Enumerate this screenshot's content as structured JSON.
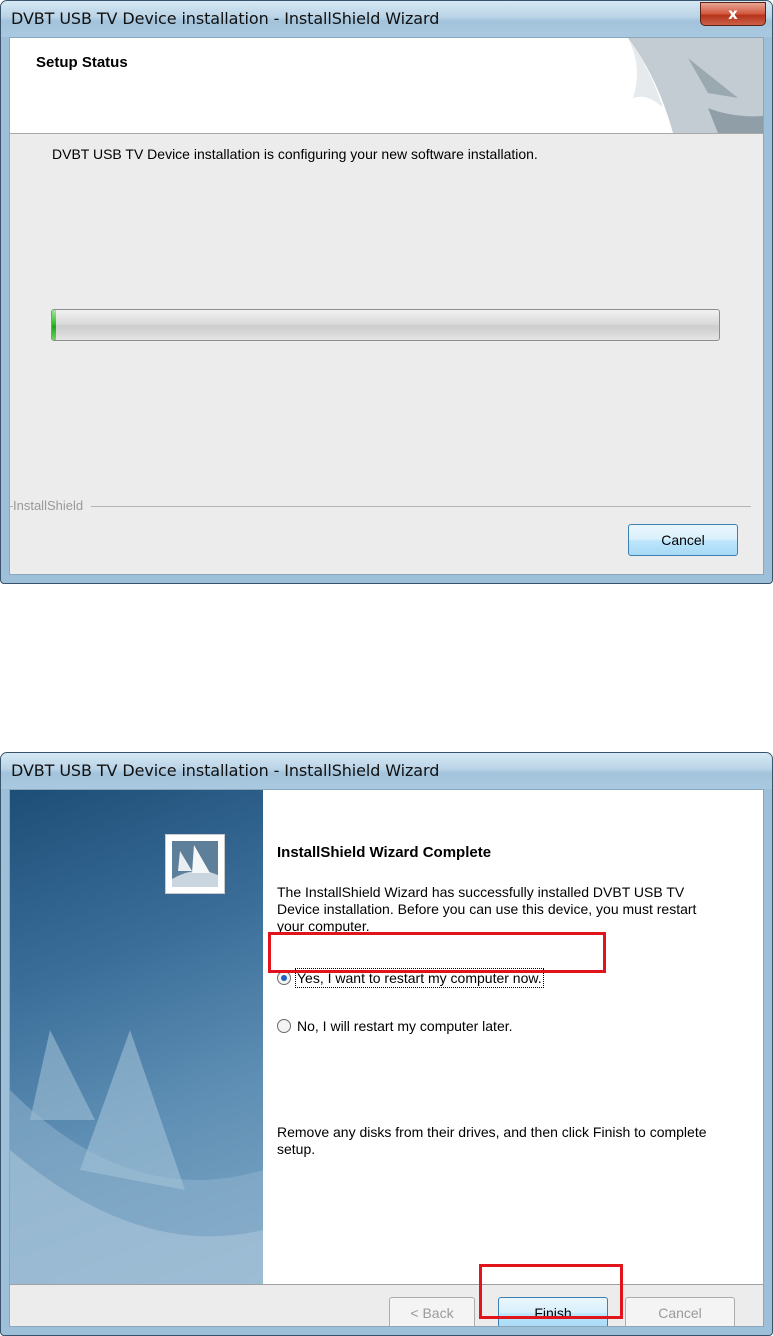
{
  "window1": {
    "title": "DVBT USB TV Device installation - InstallShield Wizard",
    "close_glyph": "x",
    "header_title": "Setup Status",
    "status_message": "DVBT USB TV Device installation is configuring your new software installation.",
    "progress_fraction": 0.006,
    "brand": "InstallShield",
    "cancel_label": "Cancel"
  },
  "window2": {
    "title": "DVBT USB TV Device installation - InstallShield Wizard",
    "heading": "InstallShield Wizard Complete",
    "body": "The InstallShield Wizard has successfully installed DVBT USB TV Device installation.  Before you can use this device, you must restart your computer.",
    "options": [
      {
        "label": "Yes, I want to restart my computer now.",
        "checked": true
      },
      {
        "label": "No, I will restart my computer later.",
        "checked": false
      }
    ],
    "remove_text": "Remove any disks from their drives, and then click Finish to complete setup.",
    "buttons": {
      "back": "< Back",
      "finish": "Finish",
      "cancel": "Cancel"
    }
  },
  "colors": {
    "highlight": "#e0141a",
    "progress_green": "#1ea514"
  }
}
